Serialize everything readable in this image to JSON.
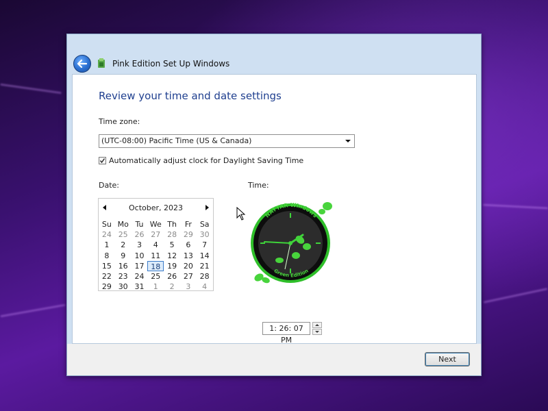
{
  "window": {
    "title": "Pink Edition Set Up Windows",
    "heading": "Review your time and date settings"
  },
  "timezone": {
    "label": "Time zone:",
    "selected": "(UTC-08:00) Pacific Time (US & Canada)"
  },
  "dst": {
    "label": "Automatically adjust clock for Daylight Saving Time",
    "checked": true
  },
  "date": {
    "label": "Date:",
    "month": "October, 2023",
    "weekdays": [
      "Su",
      "Mo",
      "Tu",
      "We",
      "Th",
      "Fr",
      "Sa"
    ],
    "weeks": [
      [
        "24",
        "25",
        "26",
        "27",
        "28",
        "29",
        "30"
      ],
      [
        "1",
        "2",
        "3",
        "4",
        "5",
        "6",
        "7"
      ],
      [
        "8",
        "9",
        "10",
        "11",
        "12",
        "13",
        "14"
      ],
      [
        "15",
        "16",
        "17",
        "18",
        "19",
        "20",
        "21"
      ],
      [
        "22",
        "23",
        "24",
        "25",
        "26",
        "27",
        "28"
      ],
      [
        "29",
        "30",
        "31",
        "1",
        "2",
        "3",
        "4"
      ]
    ],
    "selected_day": "18"
  },
  "time": {
    "label": "Time:",
    "value": "1: 26: 07 PM",
    "clock_top_text": "NATTAR Windows",
    "clock_bottom_text": "Green Edition"
  },
  "footer": {
    "next_label": "Next"
  },
  "colors": {
    "heading": "#1f3f8f",
    "clock_green": "#3fd43a",
    "selected_day": "#3b7bc8"
  }
}
